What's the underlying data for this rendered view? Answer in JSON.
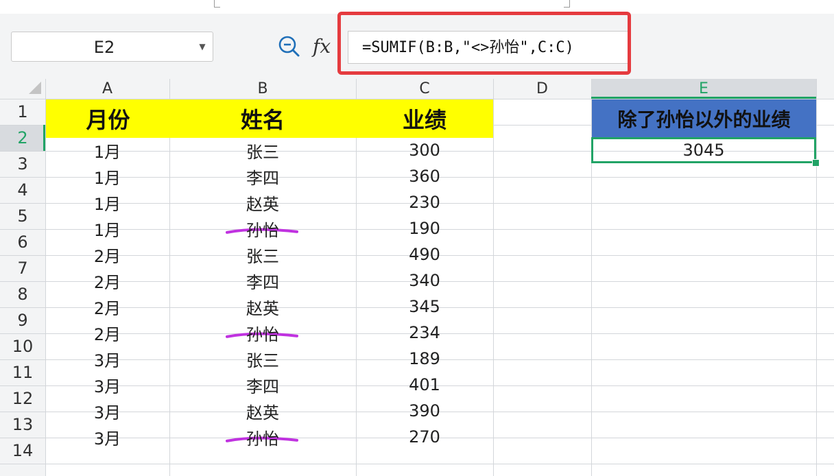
{
  "name_box": {
    "value": "E2",
    "dropdown_icon": "caret-down-icon"
  },
  "formula_bar": {
    "zoom_icon": "zoom-out-icon",
    "fx_label": "fx",
    "formula": "=SUMIF(B:B,\"<>孙怡\",C:C)"
  },
  "highlight_color": "#e53b3f",
  "columns": [
    "A",
    "B",
    "C",
    "D",
    "E"
  ],
  "rows": [
    "1",
    "2",
    "3",
    "4",
    "5",
    "6",
    "7",
    "8",
    "9",
    "10",
    "11",
    "12",
    "13",
    "14"
  ],
  "selected": {
    "row": "2",
    "column": "E"
  },
  "colors": {
    "header_yellow": "#ffff00",
    "header_blue": "#4472c4",
    "selection_green": "#21a366",
    "annotation_purple": "#c032e0"
  },
  "sheet": {
    "headers": {
      "month": "月份",
      "name": "姓名",
      "sales": "业绩",
      "result": "除了孙怡以外的业绩"
    },
    "result_value": "3045",
    "records": [
      {
        "month": "1月",
        "name": "张三",
        "sales": "300",
        "struck": false
      },
      {
        "month": "1月",
        "name": "李四",
        "sales": "360",
        "struck": false
      },
      {
        "month": "1月",
        "name": "赵英",
        "sales": "230",
        "struck": false
      },
      {
        "month": "1月",
        "name": "孙怡",
        "sales": "190",
        "struck": true
      },
      {
        "month": "2月",
        "name": "张三",
        "sales": "490",
        "struck": false
      },
      {
        "month": "2月",
        "name": "李四",
        "sales": "340",
        "struck": false
      },
      {
        "month": "2月",
        "name": "赵英",
        "sales": "345",
        "struck": false
      },
      {
        "month": "2月",
        "name": "孙怡",
        "sales": "234",
        "struck": true
      },
      {
        "month": "3月",
        "name": "张三",
        "sales": "189",
        "struck": false
      },
      {
        "month": "3月",
        "name": "李四",
        "sales": "401",
        "struck": false
      },
      {
        "month": "3月",
        "name": "赵英",
        "sales": "390",
        "struck": false
      },
      {
        "month": "3月",
        "name": "孙怡",
        "sales": "270",
        "struck": true
      }
    ]
  }
}
